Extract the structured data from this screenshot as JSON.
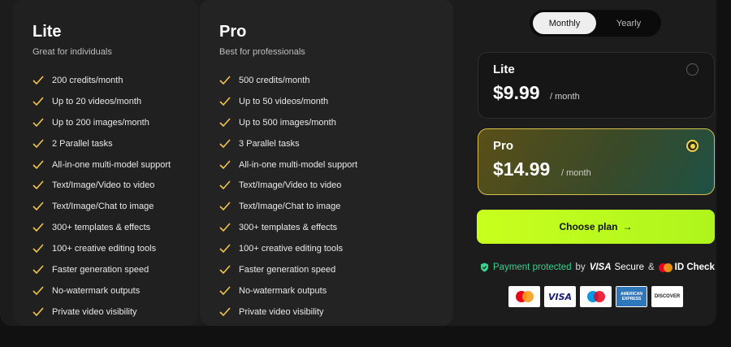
{
  "plans_columns": [
    {
      "title": "Lite",
      "subtitle": "Great for individuals",
      "features": [
        "200 credits/month",
        "Up to 20 videos/month",
        "Up to 200 images/month",
        "2 Parallel tasks",
        "All-in-one multi-model support",
        "Text/Image/Video to video",
        "Text/Image/Chat to image",
        "300+ templates & effects",
        "100+ creative editing tools",
        "Faster generation speed",
        "No-watermark outputs",
        "Private video visibility"
      ]
    },
    {
      "title": "Pro",
      "subtitle": "Best for professionals",
      "features": [
        "500 credits/month",
        "Up to 50 videos/month",
        "Up to 500 images/month",
        "3 Parallel tasks",
        "All-in-one multi-model support",
        "Text/Image/Video to video",
        "Text/Image/Chat to image",
        "300+ templates & effects",
        "100+ creative editing tools",
        "Faster generation speed",
        "No-watermark outputs",
        "Private video visibility"
      ]
    }
  ],
  "billing_toggle": {
    "monthly": "Monthly",
    "yearly": "Yearly",
    "selected": "Monthly"
  },
  "plan_options": [
    {
      "name": "Lite",
      "price": "$9.99",
      "period": "/ month",
      "selected": false
    },
    {
      "name": "Pro",
      "price": "$14.99",
      "period": "/ month",
      "selected": true
    }
  ],
  "cta": {
    "label": "Choose plan",
    "arrow": "→"
  },
  "security": {
    "protected": "Payment protected",
    "by": "by",
    "visa_secure": "Secure",
    "visa_word": "VISA",
    "amp": "&",
    "id_check": "ID Check"
  },
  "payment_cards": {
    "visa": "VISA",
    "amex": "AMERICAN EXPRESS",
    "discover": "DISCOVER"
  },
  "colors": {
    "accent": "#c8ff1e",
    "check": "#f3c64a",
    "protected_green": "#3ccf8e",
    "selected_border": "#d6c04c"
  }
}
